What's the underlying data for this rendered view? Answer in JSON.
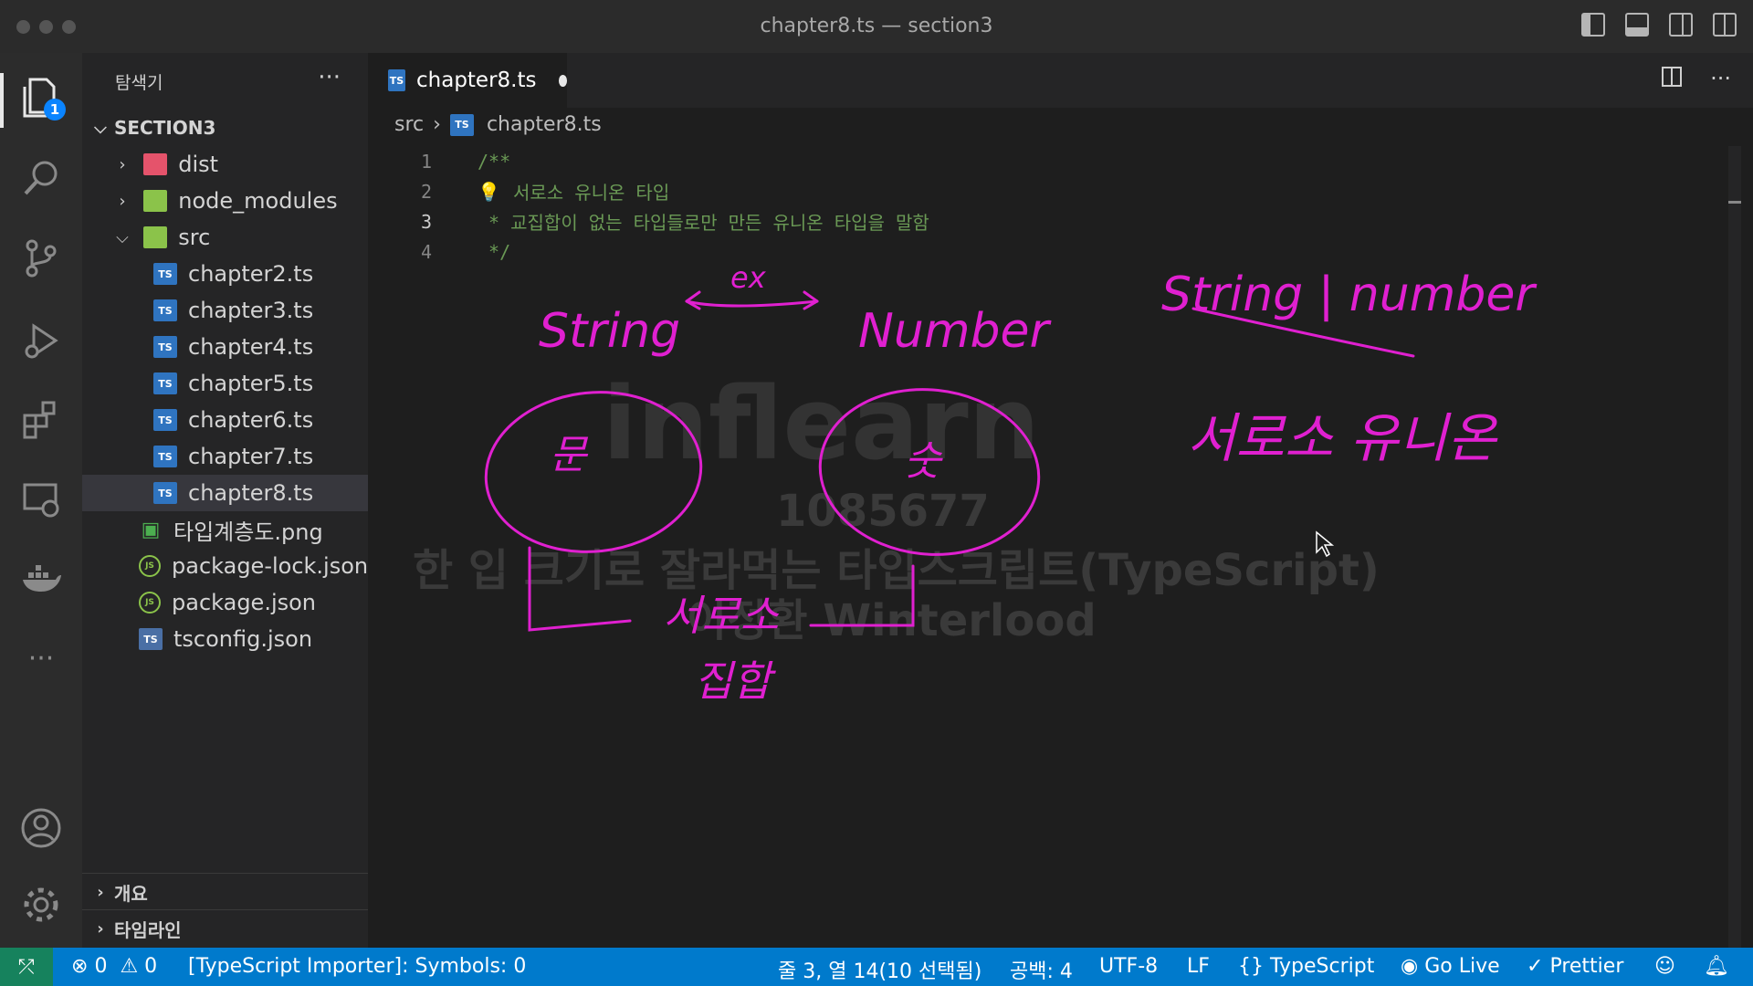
{
  "window": {
    "title": "chapter8.ts — section3"
  },
  "activity_bar": {
    "explorer_badge": "1"
  },
  "sidebar": {
    "header": "탐색기",
    "more": "···",
    "root": "SECTION3",
    "items": [
      {
        "label": "dist",
        "type": "folder"
      },
      {
        "label": "node_modules",
        "type": "folder"
      },
      {
        "label": "src",
        "type": "folder-open"
      },
      {
        "label": "chapter2.ts",
        "type": "ts"
      },
      {
        "label": "chapter3.ts",
        "type": "ts"
      },
      {
        "label": "chapter4.ts",
        "type": "ts"
      },
      {
        "label": "chapter5.ts",
        "type": "ts"
      },
      {
        "label": "chapter6.ts",
        "type": "ts"
      },
      {
        "label": "chapter7.ts",
        "type": "ts"
      },
      {
        "label": "chapter8.ts",
        "type": "ts",
        "selected": true
      },
      {
        "label": "타입계층도.png",
        "type": "png"
      },
      {
        "label": "package-lock.json",
        "type": "json"
      },
      {
        "label": "package.json",
        "type": "json"
      },
      {
        "label": "tsconfig.json",
        "type": "tsconfig"
      }
    ],
    "outline": "개요",
    "timeline": "타임라인"
  },
  "editor": {
    "tab_label": "chapter8.ts",
    "breadcrumb": {
      "folder": "src",
      "file": "chapter8.ts"
    },
    "lines": [
      {
        "num": "1",
        "text": "/**"
      },
      {
        "num": "2",
        "text": " 서로소 유니온 타입"
      },
      {
        "num": "3",
        "text": " * 교집합이 없는 타입들로만 만든 유니온 타입을 말함"
      },
      {
        "num": "4",
        "text": " */"
      }
    ]
  },
  "watermark": {
    "logo": "inflearn",
    "id": "1085677",
    "course": "한 입 크기로 잘라먹는 타입스크립트(TypeScript)",
    "author": "이정환 Winterlood"
  },
  "annotations": {
    "string": "String",
    "number": "Number",
    "x": "ex",
    "union": "String | number",
    "disjoint": "서로소 유니온",
    "circle_left": "문",
    "circle_right": "숫",
    "bottom1": "서로소",
    "bottom2": "집합"
  },
  "statusbar": {
    "errors": "0",
    "warnings": "0",
    "importer": "[TypeScript Importer]: Symbols: 0",
    "position": "줄 3, 열 14(10 선택됨)",
    "spaces": "공백: 4",
    "encoding": "UTF-8",
    "eol": "LF",
    "language": "TypeScript",
    "golive": "Go Live",
    "prettier": "Prettier"
  }
}
